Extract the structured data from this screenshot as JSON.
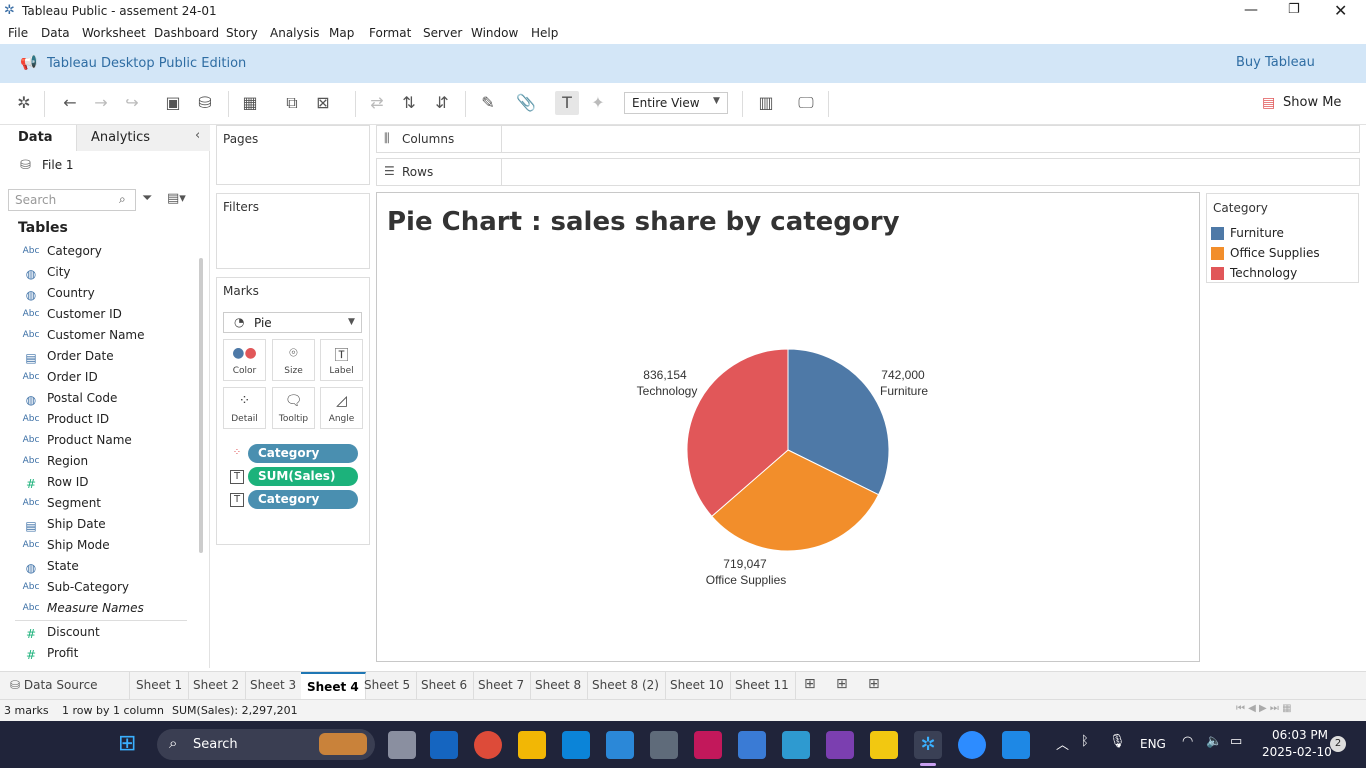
{
  "app": {
    "window_title": "Tableau Public - assement 24-01"
  },
  "menu": [
    "File",
    "Data",
    "Worksheet",
    "Dashboard",
    "Story",
    "Analysis",
    "Map",
    "Format",
    "Server",
    "Window",
    "Help"
  ],
  "banner": {
    "edition": "Tableau Desktop Public Edition",
    "buy": "Buy Tableau"
  },
  "toolbar": {
    "fit": "Entire View",
    "show_me": "Show Me"
  },
  "left": {
    "tab_data": "Data",
    "tab_analytics": "Analytics",
    "source": "File 1",
    "search_placeholder": "Search",
    "tables_heading": "Tables",
    "fields": [
      {
        "icon": "Abc",
        "name": "Category"
      },
      {
        "icon": "globe",
        "name": "City"
      },
      {
        "icon": "globe",
        "name": "Country"
      },
      {
        "icon": "Abc",
        "name": "Customer ID"
      },
      {
        "icon": "Abc",
        "name": "Customer Name"
      },
      {
        "icon": "calendar",
        "name": "Order Date"
      },
      {
        "icon": "Abc",
        "name": "Order ID"
      },
      {
        "icon": "globe",
        "name": "Postal Code"
      },
      {
        "icon": "Abc",
        "name": "Product ID"
      },
      {
        "icon": "Abc",
        "name": "Product Name"
      },
      {
        "icon": "Abc",
        "name": "Region"
      },
      {
        "icon": "#",
        "name": "Row ID"
      },
      {
        "icon": "Abc",
        "name": "Segment"
      },
      {
        "icon": "calendar",
        "name": "Ship Date"
      },
      {
        "icon": "Abc",
        "name": "Ship Mode"
      },
      {
        "icon": "globe",
        "name": "State"
      },
      {
        "icon": "Abc",
        "name": "Sub-Category"
      },
      {
        "icon": "Abc",
        "name": "Measure Names"
      },
      {
        "icon": "#",
        "name": "Discount"
      },
      {
        "icon": "#",
        "name": "Profit"
      }
    ]
  },
  "cards": {
    "pages": "Pages",
    "filters": "Filters",
    "marks": "Marks",
    "mark_type": "Pie",
    "mark_buttons": [
      "Color",
      "Size",
      "Label",
      "Detail",
      "Tooltip",
      "Angle"
    ],
    "pills": [
      {
        "label": "Category",
        "color": "#4a8fb0"
      },
      {
        "label": "SUM(Sales)",
        "color": "#1cb27b"
      },
      {
        "label": "Category",
        "color": "#4a8fb0"
      }
    ]
  },
  "shelves": {
    "columns": "Columns",
    "rows": "Rows"
  },
  "sheet_title": "Pie Chart : sales share by category",
  "legend": {
    "title": "Category",
    "items": [
      {
        "label": "Furniture",
        "color": "#4e79a7"
      },
      {
        "label": "Office Supplies",
        "color": "#f28e2b"
      },
      {
        "label": "Technology",
        "color": "#e15759"
      }
    ]
  },
  "chart_data": {
    "type": "pie",
    "title": "Pie Chart : sales share by category",
    "categories": [
      "Furniture",
      "Office Supplies",
      "Technology"
    ],
    "values": [
      742000,
      719047,
      836154
    ],
    "value_labels": [
      "742,000",
      "719,047",
      "836,154"
    ],
    "colors": [
      "#4e79a7",
      "#f28e2b",
      "#e15759"
    ]
  },
  "tabs": [
    "Data Source",
    "Sheet 1",
    "Sheet 2",
    "Sheet 3",
    "Sheet 4",
    "Sheet 5",
    "Sheet 6",
    "Sheet 7",
    "Sheet 8",
    "Sheet 8 (2)",
    "Sheet 10",
    "Sheet 11"
  ],
  "active_tab": "Sheet 4",
  "status": {
    "marks": "3 marks",
    "rows": "1 row by 1 column",
    "sum": "SUM(Sales): 2,297,201"
  },
  "taskbar": {
    "search": "Search",
    "lang": "ENG",
    "time": "06:03 PM",
    "date": "2025-02-10",
    "notif": "2"
  }
}
